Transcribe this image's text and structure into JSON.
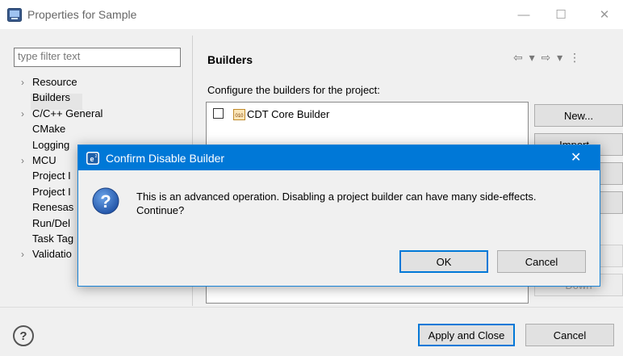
{
  "window": {
    "title": "Properties for Sample",
    "minimize_glyph": "—",
    "maximize_glyph": "☐",
    "close_glyph": "✕"
  },
  "sidebar": {
    "filter_placeholder": "type filter text",
    "items": [
      {
        "label": "Resource",
        "expandable": true
      },
      {
        "label": "Builders",
        "expandable": false,
        "selected": true
      },
      {
        "label": "C/C++ General",
        "expandable": true
      },
      {
        "label": "CMake",
        "expandable": false
      },
      {
        "label": "Logging",
        "expandable": false
      },
      {
        "label": "MCU",
        "expandable": true
      },
      {
        "label": "Project I",
        "expandable": false
      },
      {
        "label": "Project I",
        "expandable": false
      },
      {
        "label": "Renesas",
        "expandable": false
      },
      {
        "label": "Run/Del",
        "expandable": false
      },
      {
        "label": "Task Tag",
        "expandable": false
      },
      {
        "label": "Validatio",
        "expandable": true
      }
    ]
  },
  "main": {
    "page_title": "Builders",
    "nav_icons": "⇦ ▾ ⇨ ▾ ⋮",
    "configure_label": "Configure the builders for the project:",
    "builders": [
      {
        "label": "CDT Core Builder",
        "checked": false
      }
    ],
    "side_buttons": [
      "New...",
      "Import...",
      "Edit...",
      "Remove",
      "Up",
      "Down"
    ]
  },
  "footer": {
    "help_glyph": "?",
    "apply_close_label": "Apply and Close",
    "cancel_label": "Cancel"
  },
  "dialog": {
    "title": "Confirm Disable Builder",
    "close_glyph": "✕",
    "message_line1": "This is an advanced operation. Disabling a project builder can have many side-effects.",
    "message_line2": "Continue?",
    "ok_label": "OK",
    "cancel_label": "Cancel"
  },
  "colors": {
    "dialog_title_bg": "#0078d7",
    "focus_border": "#0078d7"
  }
}
